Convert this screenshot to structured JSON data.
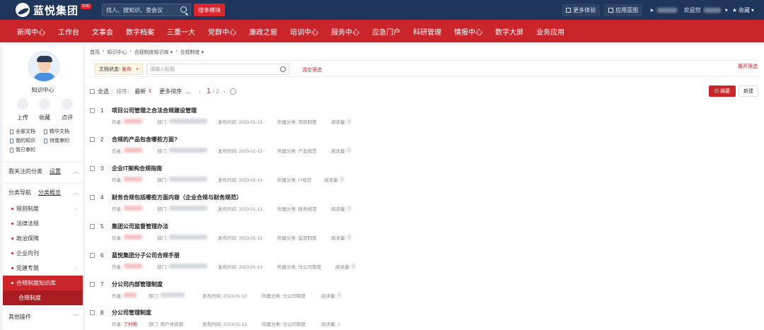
{
  "topbar": {
    "logo_text": "蓝悦集团",
    "logo_badge": "SOE",
    "search_placeholder": "找人、搜知识、查会议",
    "search_module_label": "搜本模块",
    "more_label": "更多体验",
    "app_label": "应用蓝图",
    "welcome_label": "欢迎您",
    "favorites_label": "收藏"
  },
  "nav": [
    "新闻中心",
    "工作台",
    "文事会",
    "数字档案",
    "三重一大",
    "党群中心",
    "廉政之窗",
    "培训中心",
    "服务中心",
    "应急门户",
    "科研管理",
    "情报中心",
    "数字大屏",
    "业务应用"
  ],
  "sidebar": {
    "center_name": "知识中心",
    "quick": [
      "上传",
      "收藏",
      "点评"
    ],
    "links": [
      "全部文档",
      "精华文档",
      "我的知识",
      "待我审的",
      "我已审的"
    ],
    "followed_label": "我关注的分类",
    "followed_link": "设置",
    "nav_label": "分类导航",
    "nav_link": "分类概览",
    "categories": [
      "规则制度",
      "法律法规",
      "政治保障",
      "企业内刊",
      "党建专题",
      "合规制度知识库"
    ],
    "active_sub": "合规制度",
    "other_label": "其他操作"
  },
  "main": {
    "breadcrumb": [
      "首页",
      "›",
      "知识中心",
      "›",
      "合规制度知识库 ▾",
      "›",
      "合规制度 ▾"
    ],
    "filter": {
      "label": "文档状态:",
      "value": "发布",
      "remove": "×"
    },
    "title_placeholder": "请输入标题",
    "clear_label": "清空筛选",
    "expand_label": "展开筛选",
    "toolbar": {
      "select_all": "全选",
      "sort_label": "排序:",
      "sort_value": "最新",
      "more_sort": "更多排序",
      "page_current": "1",
      "page_total": "/ 2",
      "summary_label": "☷ 摘要",
      "new_label": "新建"
    },
    "meta_labels": {
      "author": "作者:",
      "dept": "部门:",
      "date": "发布时间:",
      "cat": "所属分类:",
      "reads": "阅读量:"
    },
    "rows": [
      {
        "num": "1",
        "title": "项目公司管理之合法合规建设管理",
        "date": "2023-01-13",
        "cat": "项目制度"
      },
      {
        "num": "2",
        "title": "合规的产品包含哪些方面?",
        "date": "2023-01-13",
        "cat": "产品规范"
      },
      {
        "num": "3",
        "title": "企业IT架构合规指南",
        "date": "2023-01-13",
        "cat": "IT规范"
      },
      {
        "num": "4",
        "title": "财务合规包括哪些方面内容（企业合规与财务规范）",
        "date": "2023-01-13",
        "cat": "财务规范"
      },
      {
        "num": "5",
        "title": "集团公司监督管理办法",
        "date": "2023-01-13",
        "cat": "监管制度"
      },
      {
        "num": "6",
        "title": "蓝悦集团分子公司合规手册",
        "date": "2023-01-13",
        "cat": "分公司制度"
      },
      {
        "num": "7",
        "title": "分公司内部管理制度",
        "date": "2023-01-13",
        "cat": "分公司制度"
      },
      {
        "num": "8",
        "title": "分公司管理制度",
        "author": "丁村艳",
        "dept": "用户体验部",
        "date": "2023-01-13",
        "cat": "分公司制度",
        "reads": "1"
      }
    ]
  },
  "colors": {
    "brand_red": "#c9252b",
    "header_navy": "#1f3559"
  }
}
